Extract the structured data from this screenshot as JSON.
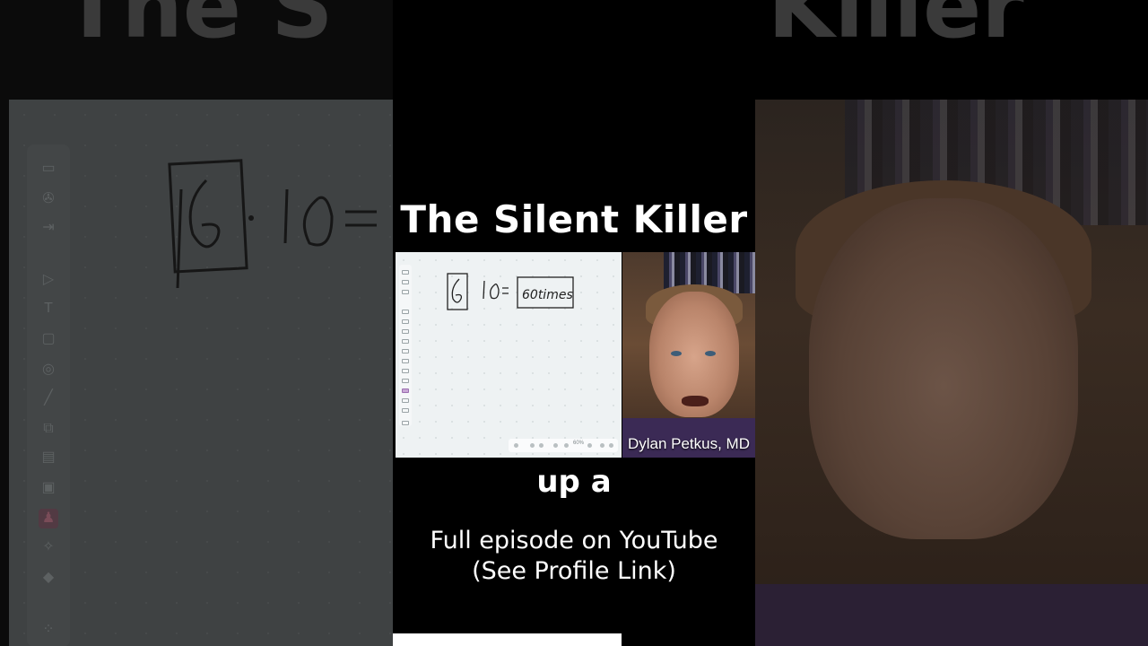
{
  "video": {
    "title": "The Silent Killer",
    "ghost_title_left": "The S",
    "ghost_title_right": "Killer",
    "caption": "up a",
    "promo_line1": "Full episode on YouTube",
    "promo_line2": "(See Profile Link)",
    "speaker_name": "Dylan Petkus, MD",
    "progress_percent": 63,
    "whiteboard_ink": "6 · 10= 60 times",
    "whiteboard_zoom": "60%"
  },
  "icons": {
    "whiteboard_tools": [
      "layout-icon",
      "pin-icon",
      "login-icon",
      "select-arrow-icon",
      "text-icon",
      "frame-icon",
      "shapes-icon",
      "line-icon",
      "copy-icon",
      "comment-icon",
      "image-icon",
      "pen-icon",
      "magic-icon",
      "diamond-icon",
      "apps-icon"
    ]
  },
  "colors": {
    "background": "#000000",
    "text": "#ffffff",
    "whiteboard": "#eef2f3",
    "active_tool": "#c9a7d6"
  }
}
